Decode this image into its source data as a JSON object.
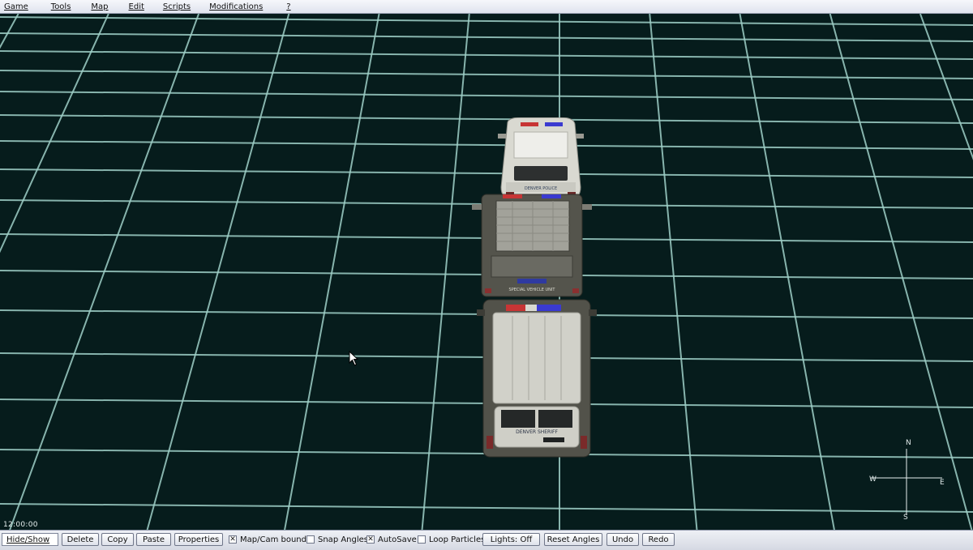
{
  "menu": [
    {
      "label": "Game"
    },
    {
      "label": "Tools"
    },
    {
      "label": "Map"
    },
    {
      "label": "Edit"
    },
    {
      "label": "Scripts"
    },
    {
      "label": "Modifications"
    },
    {
      "label": "?"
    }
  ],
  "viewport": {
    "time": "12:00:00",
    "compass": {
      "n": "N",
      "s": "S",
      "e": "E",
      "w": "W"
    },
    "vehicles": [
      {
        "name": "police-car",
        "rear_text": "DENVER  POLICE"
      },
      {
        "name": "special-vehicle-truck",
        "rear_text": "SPECIAL VEHICLE UNIT"
      },
      {
        "name": "sheriff-suv",
        "rear_text": "DENVER SHERIFF"
      }
    ]
  },
  "toolbar": {
    "hide_show": "Hide/Show",
    "delete": "Delete",
    "copy": "Copy",
    "paste": "Paste",
    "properties": "Properties",
    "map_cam_bounds": {
      "label": "Map/Cam bounds",
      "checked": true
    },
    "snap_angles": {
      "label": "Snap Angles",
      "checked": false
    },
    "autosave": {
      "label": "AutoSave",
      "checked": true
    },
    "loop_particles": {
      "label": "Loop Particles",
      "checked": false
    },
    "lights": "Lights: Off",
    "reset_angles": "Reset Angles",
    "undo": "Undo",
    "redo": "Redo"
  },
  "colors": {
    "ground": "#061c1c",
    "grid": "#9fcfc7",
    "menubar": "#e8ebf3"
  }
}
